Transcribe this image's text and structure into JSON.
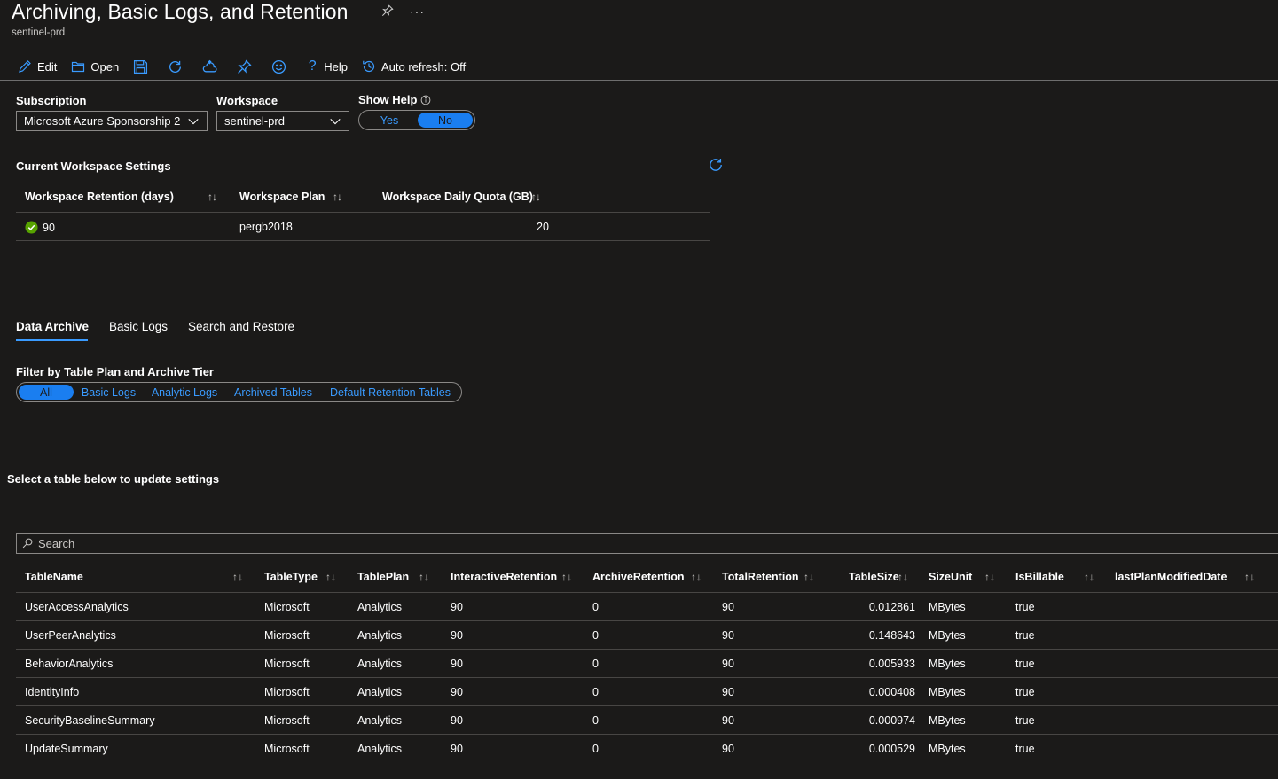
{
  "header": {
    "title": "Archiving, Basic Logs, and Retention",
    "subtitle": "sentinel-prd"
  },
  "toolbar": {
    "edit": "Edit",
    "open": "Open",
    "help": "Help",
    "auto_refresh": "Auto refresh: Off"
  },
  "params": {
    "subscription_label": "Subscription",
    "subscription_value": "Microsoft Azure Sponsorship 2",
    "workspace_label": "Workspace",
    "workspace_value": "sentinel-prd",
    "show_help_label": "Show Help",
    "show_help_options": [
      "Yes",
      "No"
    ],
    "show_help_selected": "No"
  },
  "workspace_settings": {
    "title": "Current Workspace Settings",
    "columns": [
      "Workspace Retention (days)",
      "Workspace Plan",
      "Workspace Daily Quota (GB)"
    ],
    "row": {
      "retention": "90",
      "plan": "pergb2018",
      "quota": "20"
    }
  },
  "tabs": [
    {
      "label": "Data Archive",
      "active": true
    },
    {
      "label": "Basic Logs",
      "active": false
    },
    {
      "label": "Search and Restore",
      "active": false
    }
  ],
  "filter": {
    "label": "Filter by Table Plan and Archive Tier",
    "options": [
      "All",
      "Basic Logs",
      "Analytic Logs",
      "Archived Tables",
      "Default Retention Tables"
    ],
    "selected": "All"
  },
  "select_prompt": "Select a table below to update settings",
  "search": {
    "placeholder": "Search"
  },
  "tables": {
    "columns": [
      "TableName",
      "TableType",
      "TablePlan",
      "InteractiveRetention",
      "ArchiveRetention",
      "TotalRetention",
      "TableSize",
      "SizeUnit",
      "IsBillable",
      "lastPlanModifiedDate"
    ],
    "rows": [
      [
        "UserAccessAnalytics",
        "Microsoft",
        "Analytics",
        "90",
        "0",
        "90",
        "0.012861",
        "MBytes",
        "true",
        ""
      ],
      [
        "UserPeerAnalytics",
        "Microsoft",
        "Analytics",
        "90",
        "0",
        "90",
        "0.148643",
        "MBytes",
        "true",
        ""
      ],
      [
        "BehaviorAnalytics",
        "Microsoft",
        "Analytics",
        "90",
        "0",
        "90",
        "0.005933",
        "MBytes",
        "true",
        ""
      ],
      [
        "IdentityInfo",
        "Microsoft",
        "Analytics",
        "90",
        "0",
        "90",
        "0.000408",
        "MBytes",
        "true",
        ""
      ],
      [
        "SecurityBaselineSummary",
        "Microsoft",
        "Analytics",
        "90",
        "0",
        "90",
        "0.000974",
        "MBytes",
        "true",
        ""
      ],
      [
        "UpdateSummary",
        "Microsoft",
        "Analytics",
        "90",
        "0",
        "90",
        "0.000529",
        "MBytes",
        "true",
        ""
      ]
    ]
  },
  "colors": {
    "background": "#1b1a19",
    "accent": "#3a9bff",
    "success": "#57a300"
  }
}
